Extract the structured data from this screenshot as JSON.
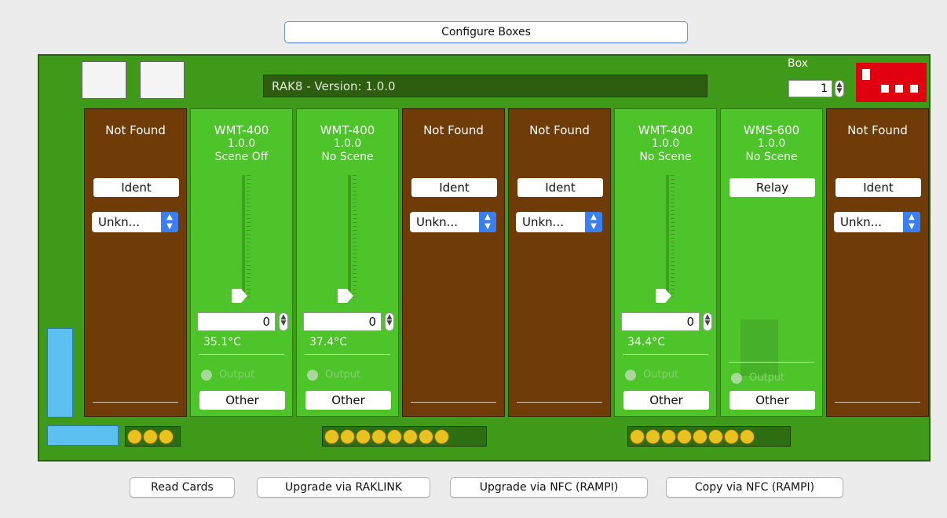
{
  "header": {
    "configure_label": "Configure Boxes"
  },
  "board": {
    "version_text": "RAK8 - Version: 1.0.0",
    "box_label": "Box",
    "box_value": "1"
  },
  "cards": [
    {
      "type": "not_found",
      "name": "Not Found",
      "ident": "Ident",
      "select": "Unkn..."
    },
    {
      "type": "wmt",
      "name": "WMT-400",
      "version": "1.0.0",
      "scene": "Scene Off",
      "value": "0",
      "temp": "35.1°C",
      "output": "Output",
      "other": "Other"
    },
    {
      "type": "wmt",
      "name": "WMT-400",
      "version": "1.0.0",
      "scene": "No Scene",
      "value": "0",
      "temp": "37.4°C",
      "output": "Output",
      "other": "Other"
    },
    {
      "type": "not_found",
      "name": "Not Found",
      "ident": "Ident",
      "select": "Unkn..."
    },
    {
      "type": "not_found",
      "name": "Not Found",
      "ident": "Ident",
      "select": "Unkn..."
    },
    {
      "type": "wmt",
      "name": "WMT-400",
      "version": "1.0.0",
      "scene": "No Scene",
      "value": "0",
      "temp": "34.4°C",
      "output": "Output",
      "other": "Other"
    },
    {
      "type": "wms",
      "name": "WMS-600",
      "version": "1.0.0",
      "scene": "No Scene",
      "relay": "Relay",
      "output": "Output",
      "other": "Other"
    },
    {
      "type": "not_found",
      "name": "Not Found",
      "ident": "Ident",
      "select": "Unkn..."
    }
  ],
  "footer": {
    "read_cards": "Read Cards",
    "upgrade_raklink": "Upgrade via RAKLINK",
    "upgrade_nfc": "Upgrade via NFC (RAMPI)",
    "copy_nfc": "Copy via NFC (RAMPI)"
  },
  "colors": {
    "board": "#3f9a1a",
    "not_found_card": "#6f3b07",
    "active_card": "#4cc42a",
    "dip_switch": "#e00010",
    "select_accent": "#3a7ff0"
  }
}
